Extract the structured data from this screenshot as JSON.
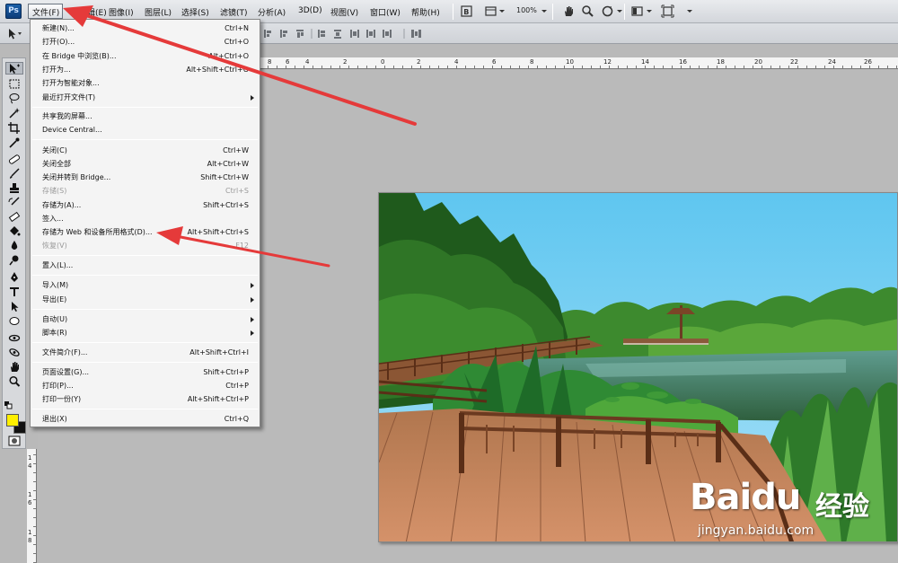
{
  "app": {
    "logo": "Ps"
  },
  "menubar": {
    "items": [
      "文件(F)",
      "编辑(E)",
      "图像(I)",
      "图层(L)",
      "选择(S)",
      "滤镜(T)",
      "分析(A)",
      "3D(D)",
      "视图(V)",
      "窗口(W)",
      "帮助(H)"
    ],
    "zoom": "100%"
  },
  "file_menu": {
    "items": [
      {
        "label": "新建(N)...",
        "shortcut": "Ctrl+N",
        "disabled": false,
        "submenu": false
      },
      {
        "label": "打开(O)...",
        "shortcut": "Ctrl+O",
        "disabled": false,
        "submenu": false
      },
      {
        "label": "在 Bridge 中浏览(B)...",
        "shortcut": "Alt+Ctrl+O",
        "disabled": false,
        "submenu": false
      },
      {
        "label": "打开为...",
        "shortcut": "Alt+Shift+Ctrl+O",
        "disabled": false,
        "submenu": false
      },
      {
        "label": "打开为智能对象...",
        "shortcut": "",
        "disabled": false,
        "submenu": false
      },
      {
        "label": "最近打开文件(T)",
        "shortcut": "",
        "disabled": false,
        "submenu": true
      },
      {
        "label": "共享我的屏幕...",
        "shortcut": "",
        "disabled": false,
        "submenu": false
      },
      {
        "label": "Device Central...",
        "shortcut": "",
        "disabled": false,
        "submenu": false
      },
      {
        "label": "关闭(C)",
        "shortcut": "Ctrl+W",
        "disabled": false,
        "submenu": false
      },
      {
        "label": "关闭全部",
        "shortcut": "Alt+Ctrl+W",
        "disabled": false,
        "submenu": false
      },
      {
        "label": "关闭并转到 Bridge...",
        "shortcut": "Shift+Ctrl+W",
        "disabled": false,
        "submenu": false
      },
      {
        "label": "存储(S)",
        "shortcut": "Ctrl+S",
        "disabled": true,
        "submenu": false
      },
      {
        "label": "存储为(A)...",
        "shortcut": "Shift+Ctrl+S",
        "disabled": false,
        "submenu": false
      },
      {
        "label": "签入...",
        "shortcut": "",
        "disabled": false,
        "submenu": false
      },
      {
        "label": "存储为 Web 和设备所用格式(D)...",
        "shortcut": "Alt+Shift+Ctrl+S",
        "disabled": false,
        "submenu": false
      },
      {
        "label": "恢复(V)",
        "shortcut": "F12",
        "disabled": true,
        "submenu": false
      },
      {
        "label": "置入(L)...",
        "shortcut": "",
        "disabled": false,
        "submenu": false
      },
      {
        "label": "导入(M)",
        "shortcut": "",
        "disabled": false,
        "submenu": true
      },
      {
        "label": "导出(E)",
        "shortcut": "",
        "disabled": false,
        "submenu": true
      },
      {
        "label": "自动(U)",
        "shortcut": "",
        "disabled": false,
        "submenu": true
      },
      {
        "label": "脚本(R)",
        "shortcut": "",
        "disabled": false,
        "submenu": true
      },
      {
        "label": "文件简介(F)...",
        "shortcut": "Alt+Shift+Ctrl+I",
        "disabled": false,
        "submenu": false
      },
      {
        "label": "页面设置(G)...",
        "shortcut": "Shift+Ctrl+P",
        "disabled": false,
        "submenu": false
      },
      {
        "label": "打印(P)...",
        "shortcut": "Ctrl+P",
        "disabled": false,
        "submenu": false
      },
      {
        "label": "打印一份(Y)",
        "shortcut": "Alt+Shift+Ctrl+P",
        "disabled": false,
        "submenu": false
      },
      {
        "label": "退出(X)",
        "shortcut": "Ctrl+Q",
        "disabled": false,
        "submenu": false
      }
    ]
  },
  "ruler_top_labels": [
    "8",
    "6",
    "4",
    "2",
    "0",
    "2",
    "4",
    "6",
    "8",
    "10",
    "12",
    "14",
    "16",
    "18",
    "20",
    "22",
    "24",
    "26"
  ],
  "ruler_left_labels": [
    "1",
    "4",
    "1",
    "6",
    "1",
    "8"
  ],
  "colors": {
    "foreground": "#ffef00",
    "background": "#111111",
    "annotation": "#e53a3a"
  },
  "watermark": {
    "brand": "Baidu",
    "brand_cn": "经验",
    "url": "jingyan.baidu.com"
  }
}
